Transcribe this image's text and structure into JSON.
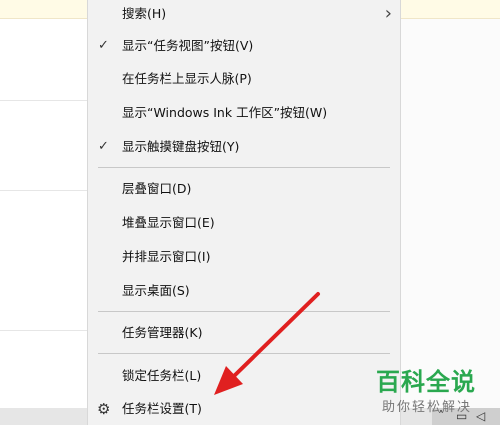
{
  "menu": {
    "items": [
      {
        "label": "搜索(H)",
        "checked": false,
        "submenu": true
      },
      {
        "label": "显示“任务视图”按钮(V)",
        "checked": true
      },
      {
        "label": "在任务栏上显示人脉(P)",
        "checked": false
      },
      {
        "label": "显示“Windows Ink 工作区”按钮(W)",
        "checked": false
      },
      {
        "label": "显示触摸键盘按钮(Y)",
        "checked": true
      },
      {
        "label": "层叠窗口(D)",
        "checked": false
      },
      {
        "label": "堆叠显示窗口(E)",
        "checked": false
      },
      {
        "label": "并排显示窗口(I)",
        "checked": false
      },
      {
        "label": "显示桌面(S)",
        "checked": false
      },
      {
        "label": "任务管理器(K)",
        "checked": false
      },
      {
        "label": "锁定任务栏(L)",
        "checked": false
      },
      {
        "label": "任务栏设置(T)",
        "checked": false,
        "icon": "gear-icon"
      }
    ]
  },
  "glyphs": {
    "check": "✓",
    "chevron": "›",
    "gear": "⚙"
  },
  "watermark": {
    "main": "百科全说",
    "sub": "助你轻松解决"
  },
  "colors": {
    "arrow": "#e02020",
    "watermark": "#2aa84f",
    "menu_bg": "#f2f2f2"
  },
  "tray_icons": [
    "caret-up-icon",
    "network-icon",
    "volume-icon"
  ]
}
